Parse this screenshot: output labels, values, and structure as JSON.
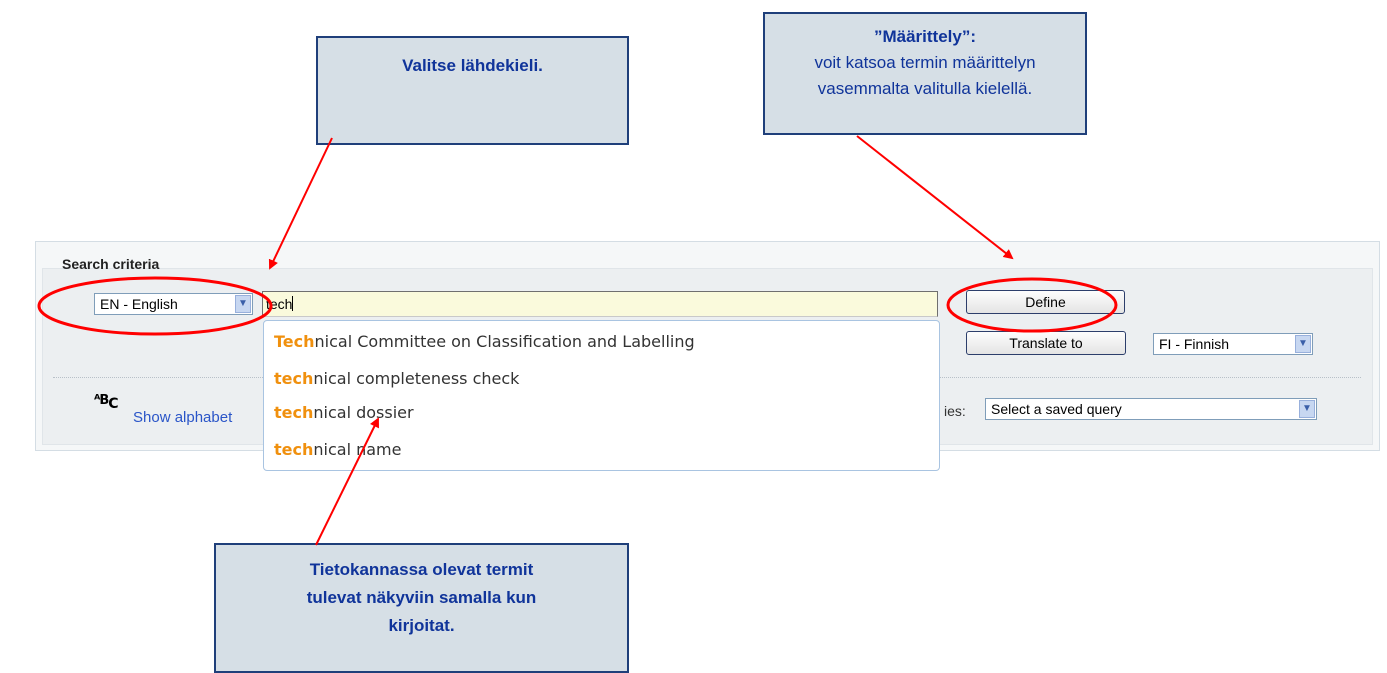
{
  "callouts": {
    "source_lang": "Valitse lähdekieli.",
    "define_title": "”Määrittely”:",
    "define_line1": "voit katsoa termin määrittelyn",
    "define_line2": "vasemmalta valitulla kielellä.",
    "terms_line1": "Tietokannassa olevat termit",
    "terms_line2": "tulevat näkyviin samalla kun",
    "terms_line3": "kirjoitat."
  },
  "search": {
    "title": "Search criteria",
    "source_language": "EN - English",
    "input_value": "tech",
    "define_label": "Define",
    "translate_label": "Translate to",
    "target_language": "FI - Finnish",
    "show_alphabetical": "Show alphabet",
    "saved_queries_label": "ies:",
    "saved_query_value": "Select a saved query"
  },
  "suggestions": [
    {
      "match": "Tech",
      "rest": "nical Committee on Classification and Labelling"
    },
    {
      "match": "tech",
      "rest": "nical completeness check"
    },
    {
      "match": "tech",
      "rest": "nical dossier"
    },
    {
      "match": "tech",
      "rest": "nical name"
    }
  ],
  "colors": {
    "callout_bg": "#d6dfe6",
    "callout_text": "#10349a",
    "annotation": "#ff0000",
    "highlight": "#f0900e",
    "link": "#2a55c8"
  },
  "icons": {
    "abc": "alphabetical-list-icon",
    "dropdown": "chevron-down-icon"
  }
}
